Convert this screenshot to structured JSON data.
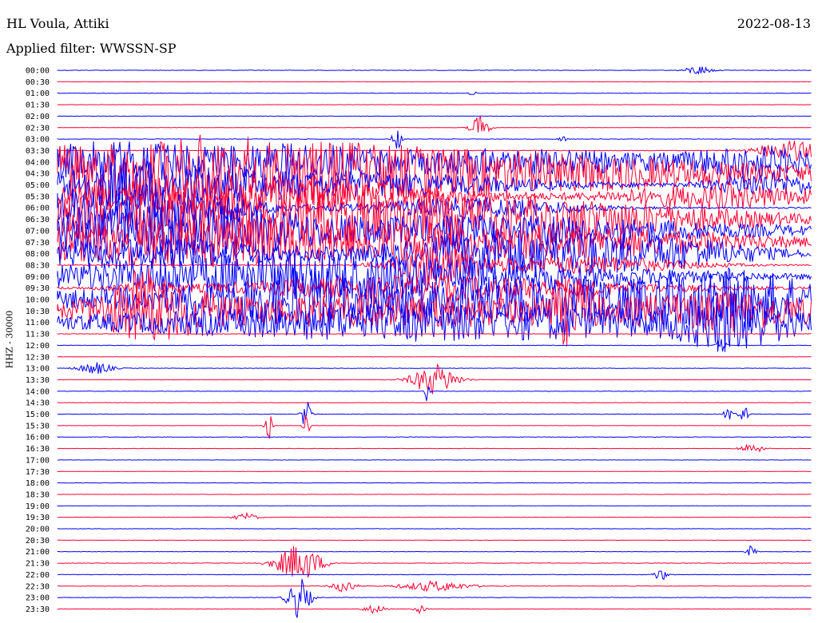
{
  "header": {
    "station": "HL Voula, Attiki",
    "date": "2022-08-13",
    "filter_label": "Applied filter: WWSSN-SP",
    "channel_label": "HHZ - 30000"
  },
  "colors": {
    "even_trace": "#0000ff",
    "odd_trace": "#ff0033"
  },
  "chart_data": {
    "type": "line",
    "title": "HL Voula, Attiki",
    "subtitle": "Applied filter: WWSSN-SP",
    "date": "2022-08-13",
    "ylabel": "HHZ - 30000",
    "grid": false,
    "tick_labels": [
      "00:00",
      "00:30",
      "01:00",
      "01:30",
      "02:00",
      "02:30",
      "03:00",
      "03:30",
      "04:00",
      "04:30",
      "05:00",
      "05:30",
      "06:00",
      "06:30",
      "07:00",
      "07:30",
      "08:00",
      "08:30",
      "09:00",
      "09:30",
      "10:00",
      "10:30",
      "11:00",
      "11:30",
      "12:00",
      "12:30",
      "13:00",
      "13:30",
      "14:00",
      "14:30",
      "15:00",
      "15:30",
      "16:00",
      "16:30",
      "17:00",
      "17:30",
      "18:00",
      "18:30",
      "19:00",
      "19:30",
      "20:00",
      "20:30",
      "21:00",
      "21:30",
      "22:00",
      "22:30",
      "23:00",
      "23:30"
    ],
    "minutes_per_row": 30,
    "series": [
      {
        "label": "00:00",
        "noise": 0.3,
        "events": [
          [
            0.85,
            0.012,
            0.45
          ]
        ]
      },
      {
        "label": "00:30",
        "noise": 0.2,
        "events": []
      },
      {
        "label": "01:00",
        "noise": 0.3,
        "events": [
          [
            0.55,
            0.003,
            0.35
          ]
        ]
      },
      {
        "label": "01:30",
        "noise": 0.2,
        "events": []
      },
      {
        "label": "02:00",
        "noise": 0.25,
        "events": []
      },
      {
        "label": "02:30",
        "noise": 0.2,
        "events": [
          [
            0.56,
            0.008,
            1.2
          ]
        ]
      },
      {
        "label": "03:00",
        "noise": 0.3,
        "events": [
          [
            0.45,
            0.004,
            1.2
          ],
          [
            0.67,
            0.004,
            0.3
          ]
        ]
      },
      {
        "label": "03:30",
        "noise": 0.4,
        "events": [
          [
            0.97,
            0.03,
            1.0
          ]
        ]
      },
      {
        "label": "04:00",
        "noise": 1.0,
        "events": [
          [
            0.07,
            0.09,
            2.0
          ],
          [
            0.3,
            0.08,
            1.4
          ],
          [
            0.6,
            0.2,
            1.2
          ],
          [
            0.93,
            0.06,
            1.3
          ]
        ]
      },
      {
        "label": "04:30",
        "noise": 1.3,
        "events": [
          [
            0.14,
            0.2,
            2.4
          ],
          [
            0.5,
            0.35,
            2.0
          ]
        ]
      },
      {
        "label": "05:00",
        "noise": 0.9,
        "events": [
          [
            0.1,
            0.1,
            2.2
          ],
          [
            0.4,
            0.18,
            1.2
          ],
          [
            0.94,
            0.05,
            1.2
          ]
        ]
      },
      {
        "label": "05:30",
        "noise": 1.1,
        "events": [
          [
            0.25,
            0.18,
            2.2
          ],
          [
            0.88,
            0.1,
            1.2
          ]
        ]
      },
      {
        "label": "06:00",
        "noise": 0.9,
        "events": [
          [
            0.1,
            0.1,
            2.5
          ],
          [
            0.55,
            0.1,
            1.0
          ]
        ]
      },
      {
        "label": "06:30",
        "noise": 1.1,
        "events": [
          [
            0.18,
            0.25,
            2.5
          ],
          [
            0.65,
            0.2,
            1.8
          ]
        ]
      },
      {
        "label": "07:00",
        "noise": 0.9,
        "events": [
          [
            0.12,
            0.15,
            2.5
          ],
          [
            0.6,
            0.25,
            1.4
          ]
        ]
      },
      {
        "label": "07:30",
        "noise": 1.0,
        "events": [
          [
            0.2,
            0.25,
            2.4
          ],
          [
            0.7,
            0.2,
            1.2
          ]
        ]
      },
      {
        "label": "08:00",
        "noise": 0.9,
        "events": [
          [
            0.12,
            0.15,
            1.5
          ],
          [
            0.58,
            0.1,
            2.2
          ],
          [
            0.8,
            0.1,
            1.6
          ]
        ]
      },
      {
        "label": "08:30",
        "noise": 0.6,
        "events": [
          [
            0.5,
            0.04,
            2.0
          ],
          [
            0.7,
            0.1,
            0.9
          ]
        ]
      },
      {
        "label": "09:00",
        "noise": 0.8,
        "events": [
          [
            0.2,
            0.2,
            1.4
          ],
          [
            0.5,
            0.25,
            1.4
          ]
        ]
      },
      {
        "label": "09:30",
        "noise": 0.8,
        "events": [
          [
            0.11,
            0.02,
            2.0
          ],
          [
            0.5,
            0.2,
            1.2
          ]
        ]
      },
      {
        "label": "10:00",
        "noise": 1.1,
        "events": [
          [
            0.3,
            0.05,
            1.2
          ],
          [
            0.5,
            0.35,
            2.2
          ],
          [
            0.9,
            0.08,
            1.8
          ]
        ]
      },
      {
        "label": "10:30",
        "noise": 1.0,
        "events": [
          [
            0.12,
            0.06,
            2.2
          ],
          [
            0.45,
            0.25,
            1.6
          ],
          [
            0.68,
            0.02,
            2.4
          ],
          [
            0.9,
            0.1,
            1.6
          ]
        ]
      },
      {
        "label": "11:00",
        "noise": 0.8,
        "events": [
          [
            0.5,
            0.35,
            1.8
          ],
          [
            0.9,
            0.05,
            2.2
          ]
        ]
      },
      {
        "label": "11:30",
        "noise": 0.3,
        "events": []
      },
      {
        "label": "12:00",
        "noise": 0.3,
        "events": [
          [
            0.88,
            0.004,
            0.8
          ]
        ]
      },
      {
        "label": "12:30",
        "noise": 0.2,
        "events": []
      },
      {
        "label": "13:00",
        "noise": 0.3,
        "events": [
          [
            0.05,
            0.015,
            0.6
          ]
        ]
      },
      {
        "label": "13:30",
        "noise": 0.2,
        "events": [
          [
            0.5,
            0.02,
            1.5
          ]
        ]
      },
      {
        "label": "14:00",
        "noise": 0.3,
        "events": [
          [
            0.49,
            0.002,
            1.0
          ]
        ]
      },
      {
        "label": "14:30",
        "noise": 0.25,
        "events": []
      },
      {
        "label": "15:00",
        "noise": 0.3,
        "events": [
          [
            0.33,
            0.004,
            1.7
          ],
          [
            0.89,
            0.004,
            0.8
          ],
          [
            0.91,
            0.004,
            0.9
          ]
        ]
      },
      {
        "label": "15:30",
        "noise": 0.2,
        "events": [
          [
            0.28,
            0.003,
            1.5
          ],
          [
            0.33,
            0.003,
            1.4
          ]
        ]
      },
      {
        "label": "16:00",
        "noise": 0.3,
        "events": []
      },
      {
        "label": "16:30",
        "noise": 0.25,
        "events": [
          [
            0.92,
            0.01,
            0.5
          ]
        ]
      },
      {
        "label": "17:00",
        "noise": 0.2,
        "events": []
      },
      {
        "label": "17:30",
        "noise": 0.2,
        "events": []
      },
      {
        "label": "18:00",
        "noise": 0.25,
        "events": []
      },
      {
        "label": "18:30",
        "noise": 0.2,
        "events": []
      },
      {
        "label": "19:00",
        "noise": 0.2,
        "events": []
      },
      {
        "label": "19:30",
        "noise": 0.25,
        "events": [
          [
            0.25,
            0.01,
            0.4
          ]
        ]
      },
      {
        "label": "20:00",
        "noise": 0.25,
        "events": []
      },
      {
        "label": "20:30",
        "noise": 0.2,
        "events": []
      },
      {
        "label": "21:00",
        "noise": 0.25,
        "events": [
          [
            0.92,
            0.004,
            0.6
          ]
        ]
      },
      {
        "label": "21:30",
        "noise": 0.3,
        "events": [
          [
            0.32,
            0.02,
            1.8
          ]
        ]
      },
      {
        "label": "22:00",
        "noise": 0.3,
        "events": [
          [
            0.8,
            0.006,
            0.6
          ]
        ]
      },
      {
        "label": "22:30",
        "noise": 0.3,
        "events": [
          [
            0.38,
            0.01,
            0.6
          ],
          [
            0.5,
            0.03,
            0.5
          ]
        ]
      },
      {
        "label": "23:00",
        "noise": 0.3,
        "events": [
          [
            0.32,
            0.01,
            2.0
          ]
        ]
      },
      {
        "label": "23:30",
        "noise": 0.25,
        "events": [
          [
            0.42,
            0.01,
            0.4
          ],
          [
            0.48,
            0.005,
            0.4
          ]
        ]
      }
    ]
  }
}
